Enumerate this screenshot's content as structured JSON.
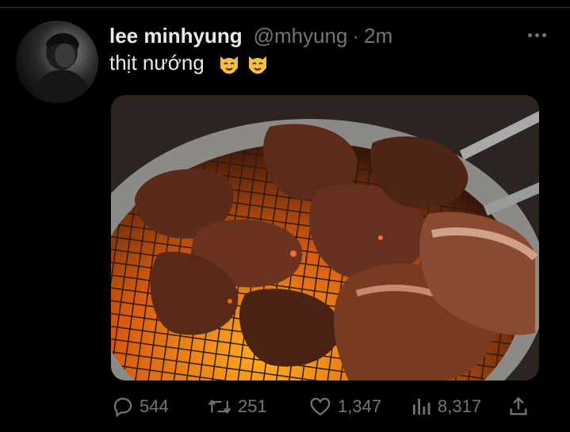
{
  "tweet": {
    "author_name": "lee minhyung",
    "handle": "@mhyung",
    "separator": "·",
    "time": "2m",
    "text": "thịt nướng",
    "emojis": [
      "smiling-cat-face-icon",
      "smiling-cat-face-icon"
    ],
    "media_description_icon": "grilled-meat-photo"
  },
  "actions": {
    "replies": "544",
    "retweets": "251",
    "likes": "1,347",
    "views": "8,317"
  },
  "colors": {
    "background": "#000000",
    "primary_text": "#e7e9ea",
    "secondary_text": "#71767b"
  }
}
